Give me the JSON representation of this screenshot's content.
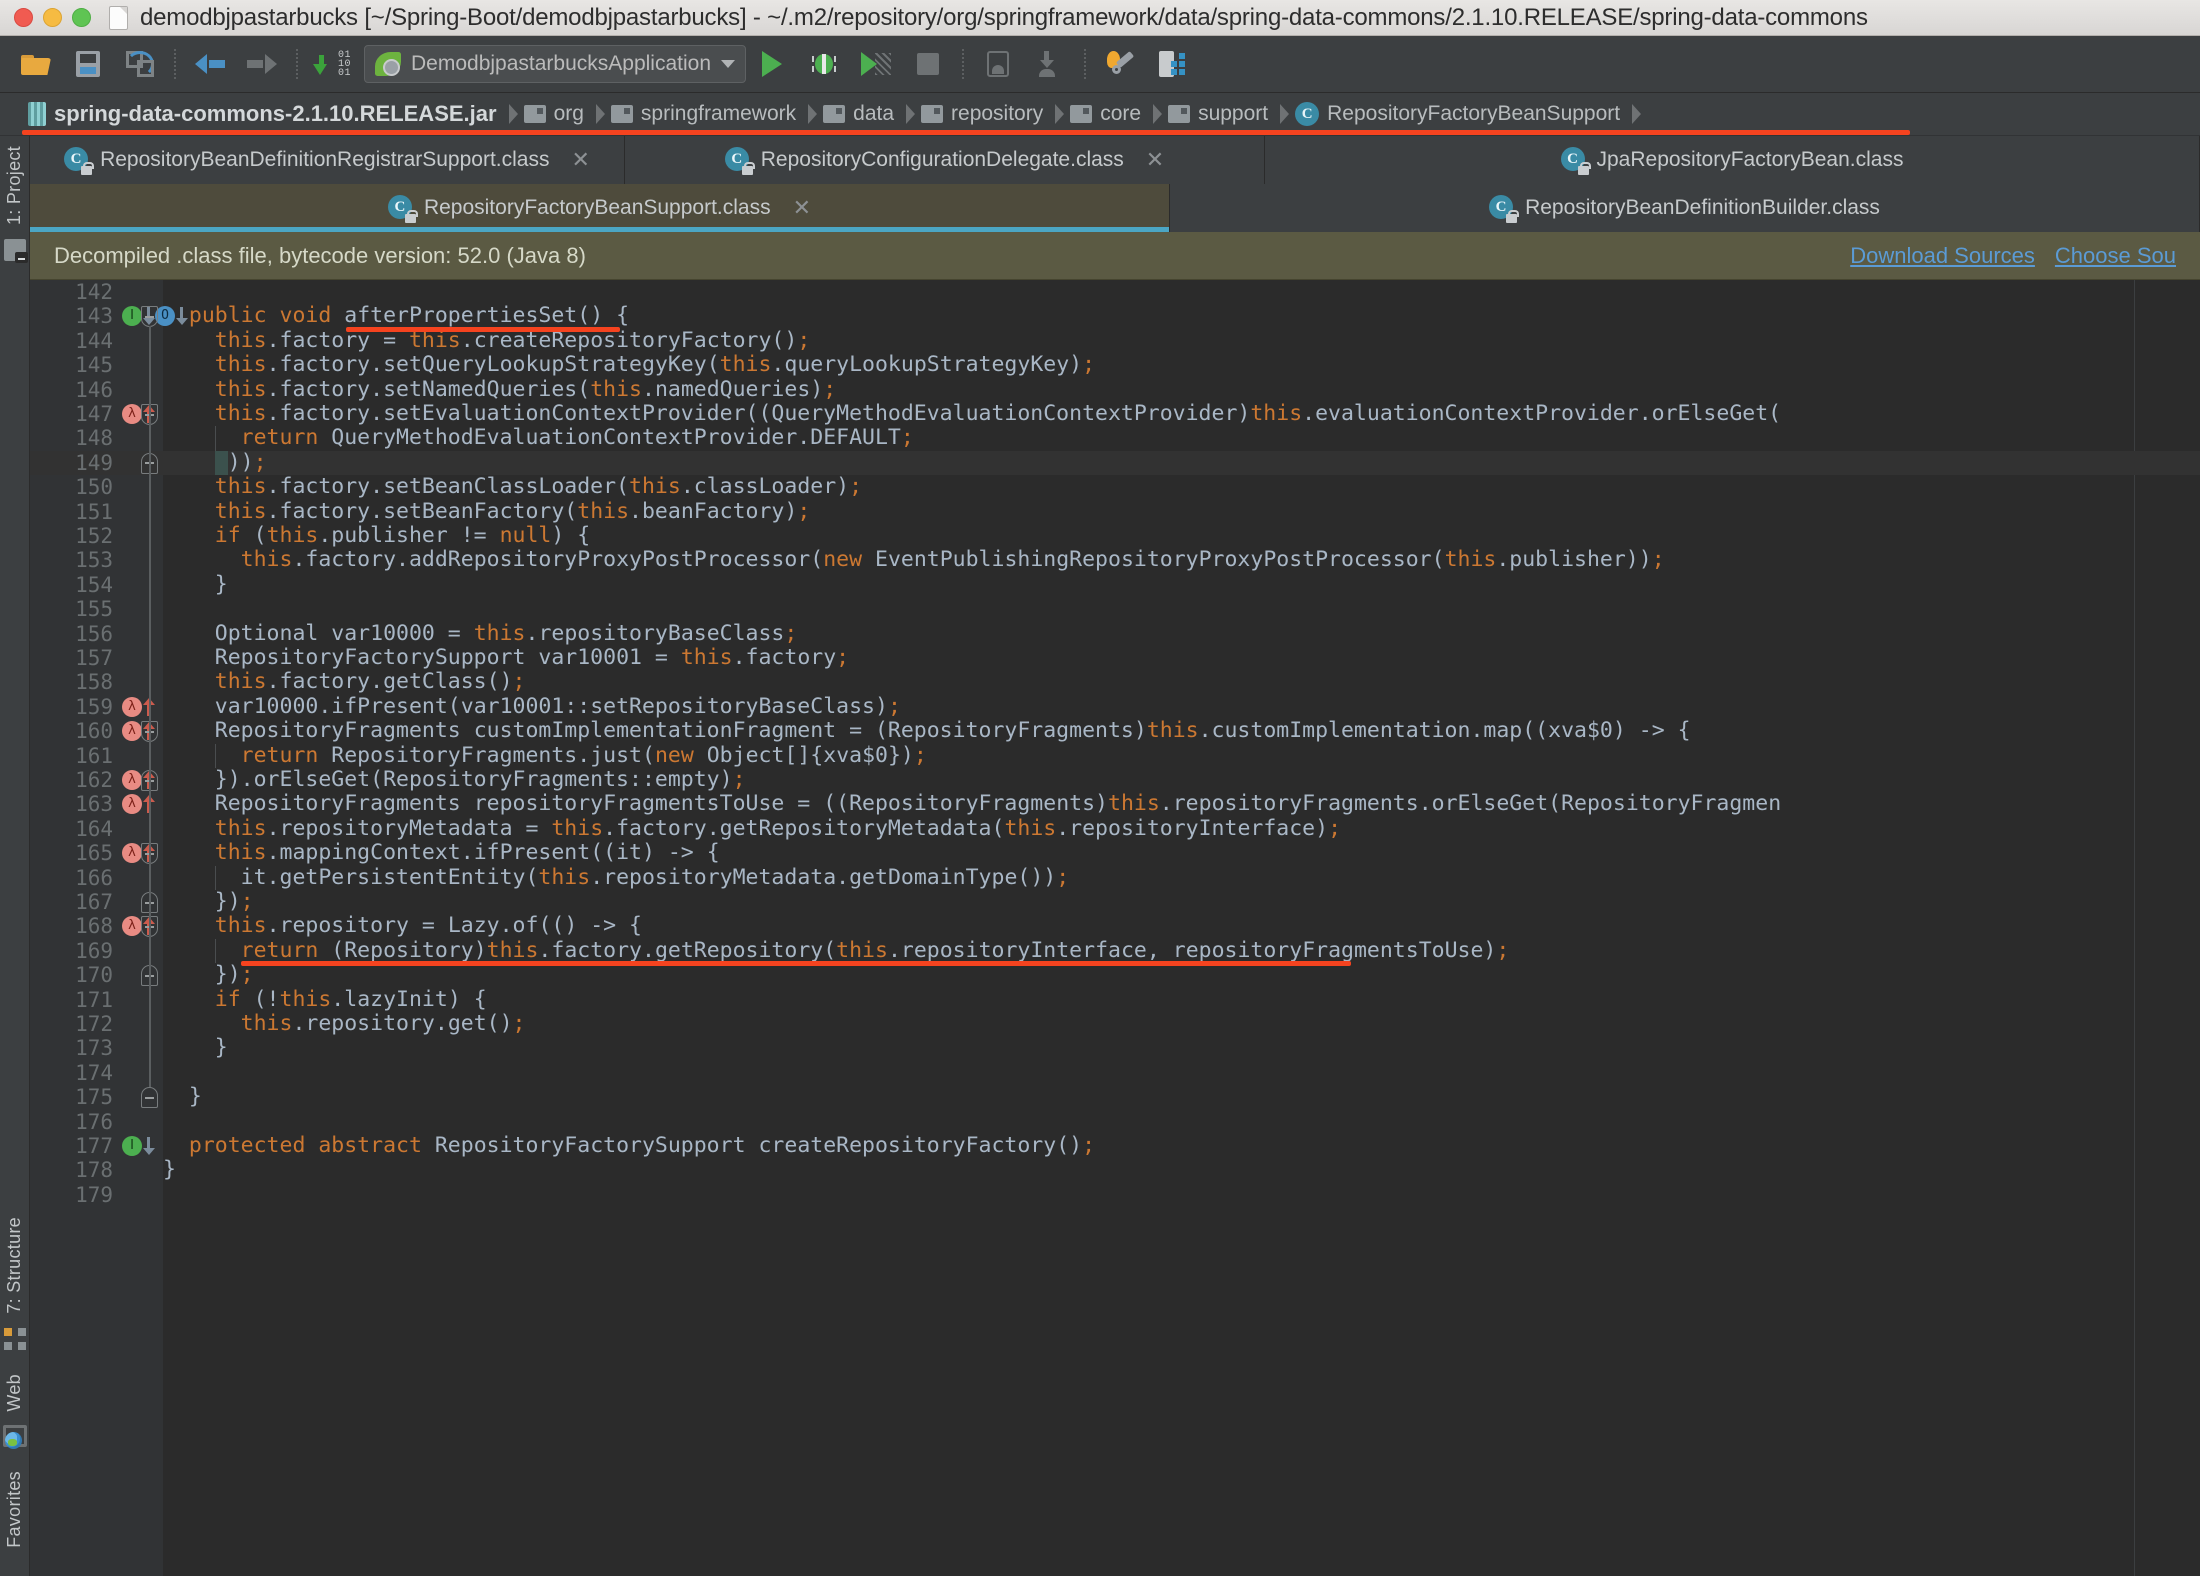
{
  "window": {
    "title": "demodbjpastarbucks [~/Spring-Boot/demodbjpastarbucks] - ~/.m2/repository/org/springframework/data/spring-data-commons/2.1.10.RELEASE/spring-data-commons",
    "controls": {
      "close": "close-button",
      "minimize": "minimize-button",
      "maximize": "maximize-button"
    }
  },
  "toolbar": {
    "icons": [
      {
        "name": "open-project-icon",
        "label": "Open"
      },
      {
        "name": "save-all-icon",
        "label": "Save All"
      },
      {
        "name": "synchronize-icon",
        "label": "Synchronize"
      },
      {
        "name": "navigate-back-icon",
        "label": "Back"
      },
      {
        "name": "navigate-forward-icon",
        "label": "Forward"
      },
      {
        "name": "compile-icon",
        "label": "Compile"
      }
    ],
    "run_config": "DemodbjpastarbucksApplication",
    "run_label": "Run",
    "debug_label": "Debug",
    "coverage_label": "Run with Coverage",
    "stop_label": "Stop",
    "device_label": "AVD Manager",
    "sdk_label": "SDK Manager",
    "wrench_label": "Project Structure",
    "struct_label": "Database"
  },
  "breadcrumb": {
    "items": [
      {
        "label": "spring-data-commons-2.1.10.RELEASE.jar",
        "icon": "jar-icon",
        "type": "jar"
      },
      {
        "label": "org",
        "icon": "package-icon",
        "type": "package"
      },
      {
        "label": "springframework",
        "icon": "package-icon",
        "type": "package"
      },
      {
        "label": "data",
        "icon": "package-icon",
        "type": "package"
      },
      {
        "label": "repository",
        "icon": "package-icon",
        "type": "package"
      },
      {
        "label": "core",
        "icon": "package-icon",
        "type": "package"
      },
      {
        "label": "support",
        "icon": "package-icon",
        "type": "package"
      },
      {
        "label": "RepositoryFactoryBeanSupport",
        "icon": "class-icon",
        "type": "class",
        "badge": "C"
      }
    ],
    "annotation_color": "#f5431f"
  },
  "editor_tabs": {
    "row1": [
      {
        "label": "RepositoryBeanDefinitionRegistrarSupport.class",
        "badge": "C",
        "active": false,
        "closable": true
      },
      {
        "label": "RepositoryConfigurationDelegate.class",
        "badge": "C",
        "active": false,
        "closable": true
      },
      {
        "label": "JpaRepositoryFactoryBean.class",
        "badge": "C",
        "active": false,
        "closable": false
      }
    ],
    "row2": [
      {
        "label": "RepositoryFactoryBeanSupport.class",
        "badge": "C",
        "active": true,
        "closable": true
      },
      {
        "label": "RepositoryBeanDefinitionBuilder.class",
        "badge": "C",
        "active": false,
        "closable": false
      }
    ],
    "close_glyph": "✕"
  },
  "notice": {
    "text": "Decompiled .class file, bytecode version: 52.0 (Java 8)",
    "links": [
      "Download Sources",
      "Choose Sou"
    ],
    "background": "#5b5a43",
    "link_color": "#5b9bd5"
  },
  "sidebar": {
    "items": [
      {
        "label": "1: Project",
        "icon": "project-icon"
      },
      {
        "label": "7: Structure",
        "icon": "structure-icon"
      },
      {
        "label": "Web",
        "icon": "web-icon"
      },
      {
        "label": "Favorites",
        "icon": "favorites-icon"
      }
    ]
  },
  "editor": {
    "first_visible_line": 142,
    "last_visible_line": 179,
    "highlighted_line": 149,
    "annotations": [
      {
        "line": 143,
        "text": "afterPropertiesSet()"
      },
      {
        "line": 169,
        "text": "return (Repository)this.factory.getRepository(this.repositoryInterface, repositoryFragmentsToUse);"
      }
    ],
    "lines": [
      {
        "no": 142,
        "text": ""
      },
      {
        "no": 143,
        "text": "  public void afterPropertiesSet() {",
        "markers": [
          "implemented",
          "overridden"
        ],
        "fold": "start"
      },
      {
        "no": 144,
        "text": "    this.factory = this.createRepositoryFactory();"
      },
      {
        "no": 145,
        "text": "    this.factory.setQueryLookupStrategyKey(this.queryLookupStrategyKey);"
      },
      {
        "no": 146,
        "text": "    this.factory.setNamedQueries(this.namedQueries);"
      },
      {
        "no": 147,
        "text": "    this.factory.setEvaluationContextProvider((QueryMethodEvaluationContextProvider)this.evaluationContextProvider.orElseGet(",
        "markers": [
          "lambda"
        ],
        "fold": "start"
      },
      {
        "no": 148,
        "text": "      return QueryMethodEvaluationContextProvider.DEFAULT;"
      },
      {
        "no": 149,
        "text": "    }));",
        "fold": "end",
        "current": true
      },
      {
        "no": 150,
        "text": "    this.factory.setBeanClassLoader(this.classLoader);"
      },
      {
        "no": 151,
        "text": "    this.factory.setBeanFactory(this.beanFactory);"
      },
      {
        "no": 152,
        "text": "    if (this.publisher != null) {"
      },
      {
        "no": 153,
        "text": "      this.factory.addRepositoryProxyPostProcessor(new EventPublishingRepositoryProxyPostProcessor(this.publisher));"
      },
      {
        "no": 154,
        "text": "    }"
      },
      {
        "no": 155,
        "text": ""
      },
      {
        "no": 156,
        "text": "    Optional var10000 = this.repositoryBaseClass;"
      },
      {
        "no": 157,
        "text": "    RepositoryFactorySupport var10001 = this.factory;"
      },
      {
        "no": 158,
        "text": "    this.factory.getClass();"
      },
      {
        "no": 159,
        "text": "    var10000.ifPresent(var10001::setRepositoryBaseClass);",
        "markers": [
          "lambda"
        ]
      },
      {
        "no": 160,
        "text": "    RepositoryFragments customImplementationFragment = (RepositoryFragments)this.customImplementation.map((xva$0) -> {",
        "markers": [
          "lambda"
        ],
        "fold": "start"
      },
      {
        "no": 161,
        "text": "      return RepositoryFragments.just(new Object[]{xva$0});"
      },
      {
        "no": 162,
        "text": "    }).orElseGet(RepositoryFragments::empty);",
        "markers": [
          "lambda"
        ],
        "fold": "end"
      },
      {
        "no": 163,
        "text": "    RepositoryFragments repositoryFragmentsToUse = ((RepositoryFragments)this.repositoryFragments.orElseGet(RepositoryFragmen",
        "markers": [
          "lambda"
        ]
      },
      {
        "no": 164,
        "text": "    this.repositoryMetadata = this.factory.getRepositoryMetadata(this.repositoryInterface);"
      },
      {
        "no": 165,
        "text": "    this.mappingContext.ifPresent((it) -> {",
        "markers": [
          "lambda"
        ],
        "fold": "start"
      },
      {
        "no": 166,
        "text": "      it.getPersistentEntity(this.repositoryMetadata.getDomainType());"
      },
      {
        "no": 167,
        "text": "    });",
        "fold": "end"
      },
      {
        "no": 168,
        "text": "    this.repository = Lazy.of(() -> {",
        "markers": [
          "lambda"
        ],
        "fold": "start"
      },
      {
        "no": 169,
        "text": "      return (Repository)this.factory.getRepository(this.repositoryInterface, repositoryFragmentsToUse);"
      },
      {
        "no": 170,
        "text": "    });",
        "fold": "end"
      },
      {
        "no": 171,
        "text": "    if (!this.lazyInit) {"
      },
      {
        "no": 172,
        "text": "      this.repository.get();"
      },
      {
        "no": 173,
        "text": "    }"
      },
      {
        "no": 174,
        "text": ""
      },
      {
        "no": 175,
        "text": "  }",
        "fold": "end"
      },
      {
        "no": 176,
        "text": ""
      },
      {
        "no": 177,
        "text": "  protected abstract RepositoryFactorySupport createRepositoryFactory();",
        "markers": [
          "implemented"
        ]
      },
      {
        "no": 178,
        "text": "}"
      },
      {
        "no": 179,
        "text": ""
      }
    ],
    "colors": {
      "background": "#2b2b2b",
      "gutter": "#313335",
      "default_text": "#a9b7c6",
      "keyword": "#cc7832",
      "number": "#6897bb",
      "line_number": "#6a6f71",
      "current_line": "#323232"
    }
  }
}
